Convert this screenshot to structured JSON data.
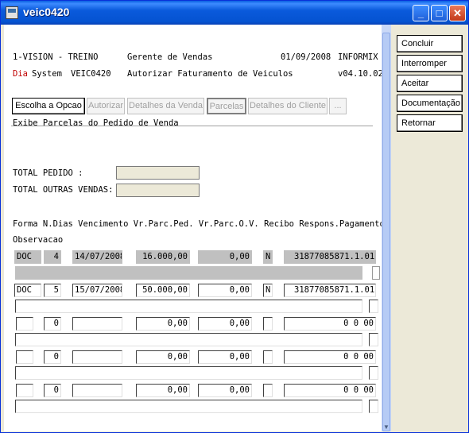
{
  "window": {
    "title": "veic0420"
  },
  "header": {
    "company": "1-VISION - TREINO",
    "role": "Gerente de Vendas",
    "date": "01/09/2008",
    "db": "INFORMIX",
    "day_label": "Dia",
    "system_label": "System",
    "program": "VEIC0420",
    "description": "Autorizar Faturamento de Veiculos",
    "version": "v04.10.02"
  },
  "tabs": [
    "Escolha a Opcao",
    "Autorizar",
    "Detalhes da Venda",
    "Parcelas",
    "Detalhes do Cliente",
    "..."
  ],
  "status_line": "Exibe Parcelas do Pedido de Venda",
  "totals": {
    "pedido_label": "TOTAL PEDIDO       :",
    "outras_label": "TOTAL OUTRAS VENDAS:"
  },
  "columns": {
    "header": "Forma N.Dias Vencimento  Vr.Parc.Ped. Vr.Parc.O.V. Recibo  Respons.Pagamento",
    "obs": "Observacao"
  },
  "rows": [
    {
      "forma": "DOC",
      "dias": "4",
      "venc": "14/07/2008",
      "vrped": "16.000,00",
      "vrov": "0,00",
      "recibo": "N",
      "resp": "31877085871.1.01"
    },
    {
      "forma": "DOC",
      "dias": "5",
      "venc": "15/07/2008",
      "vrped": "50.000,00",
      "vrov": "0,00",
      "recibo": "N",
      "resp": "31877085871.1.01"
    },
    {
      "forma": "",
      "dias": "0",
      "venc": "",
      "vrped": "0,00",
      "vrov": "0,00",
      "recibo": "",
      "resp": "0 0 00"
    },
    {
      "forma": "",
      "dias": "0",
      "venc": "",
      "vrped": "0,00",
      "vrov": "0,00",
      "recibo": "",
      "resp": "0 0 00"
    },
    {
      "forma": "",
      "dias": "0",
      "venc": "",
      "vrped": "0,00",
      "vrov": "0,00",
      "recibo": "",
      "resp": "0 0 00"
    }
  ],
  "side_buttons": [
    "Concluir",
    "Interromper",
    "Aceitar",
    "Documentação",
    "Retornar"
  ]
}
